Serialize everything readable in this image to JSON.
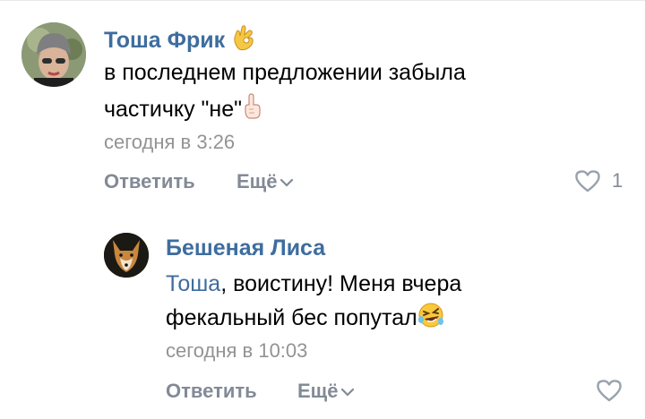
{
  "comments": [
    {
      "author": "Тоша Фрик",
      "author_emoji": "ok-hand-icon",
      "text_line1": "в последнем предложении забыла",
      "text_line2": "частичку \"не\"",
      "text_emoji": "pointing-up-icon",
      "time": "сегодня в 3:26",
      "reply_label": "Ответить",
      "more_label": "Ещё",
      "like_count": "1"
    },
    {
      "author": "Бешеная Лиса",
      "mention": "Тоша",
      "text_line1_rest": ", воистину! Меня вчера",
      "text_line2": "фекальный бес попутал",
      "text_emoji": "rolling-laughing-icon",
      "time": "сегодня в 10:03",
      "reply_label": "Ответить",
      "more_label": "Ещё",
      "like_count": ""
    }
  ],
  "colors": {
    "link": "#3e6d9e",
    "meta": "#939393",
    "action": "#828a96"
  }
}
